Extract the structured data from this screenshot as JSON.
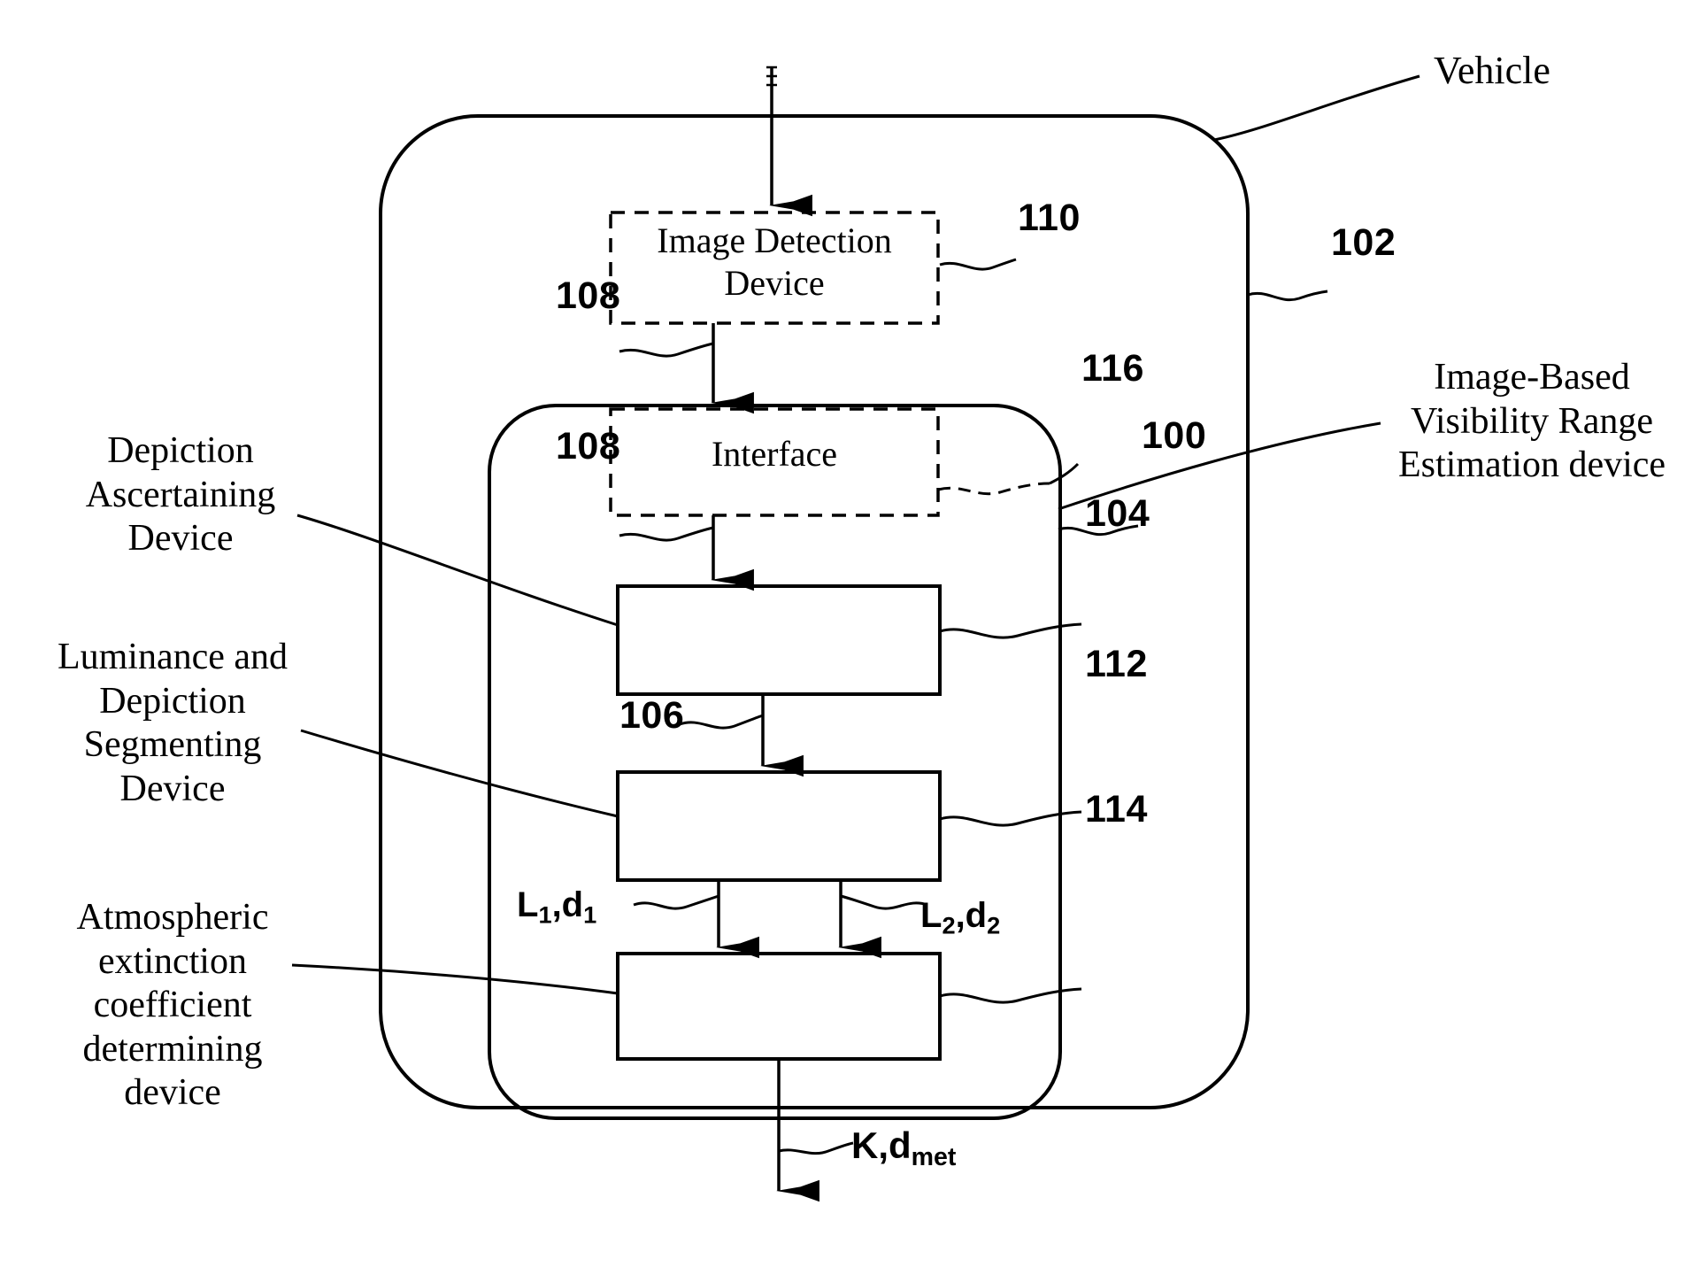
{
  "figure": {
    "type": "patent-block-diagram",
    "background": "#ffffff",
    "line_color": "#000000"
  },
  "outer_boundary": {
    "name": "vehicle-boundary",
    "label": "Vehicle",
    "reference": "102",
    "style": "solid rounded rectangle"
  },
  "inner_boundary": {
    "name": "visibility-range-estimation-boundary",
    "label": "Image-Based\nVisibility Range\nEstimation device",
    "reference": "100",
    "style": "solid rounded rectangle"
  },
  "blocks": [
    {
      "id": "image-detection-device",
      "label": "Image Detection\nDevice",
      "reference": "110",
      "border": "dashed"
    },
    {
      "id": "interface",
      "label": "Interface",
      "reference": "116",
      "border": "dashed"
    },
    {
      "id": "depiction-ascertaining-device",
      "label": "Depiction\nAscertaining\nDevice",
      "reference": "104",
      "border": "solid",
      "label_position": "left"
    },
    {
      "id": "luminance-and-depiction-segmenting-device",
      "label": "Luminance and\nDepiction\nSegmenting\nDevice",
      "reference": "112",
      "border": "solid",
      "label_position": "left"
    },
    {
      "id": "atmospheric-extinction-coefficient-determining-device",
      "label": "Atmospheric\nextinction\ncoefficient\ndetermining\ndevice",
      "reference": "114",
      "border": "solid",
      "label_position": "left"
    }
  ],
  "connectors": [
    {
      "id": "input-to-image-detection-device",
      "reference": null,
      "from": "external-input",
      "to": "image-detection-device"
    },
    {
      "id": "image-detection-to-interface",
      "reference": "108",
      "from": "image-detection-device",
      "to": "interface"
    },
    {
      "id": "interface-to-depiction-ascertaining",
      "reference": "108",
      "from": "interface",
      "to": "depiction-ascertaining-device"
    },
    {
      "id": "depiction-to-segmenting",
      "reference": "106",
      "from": "depiction-ascertaining-device",
      "to": "luminance-and-depiction-segmenting-device"
    },
    {
      "id": "segmenting-to-extinction-left",
      "signal": "L1,d1",
      "signal_base": "L",
      "from": "luminance-and-depiction-segmenting-device",
      "to": "atmospheric-extinction-coefficient-determining-device"
    },
    {
      "id": "segmenting-to-extinction-right",
      "signal": "L2,d2",
      "from": "luminance-and-depiction-segmenting-device",
      "to": "atmospheric-extinction-coefficient-determining-device"
    },
    {
      "id": "extinction-output",
      "signal": "K,dmet",
      "from": "atmospheric-extinction-coefficient-determining-device",
      "to": "external-output"
    }
  ],
  "signals": {
    "l1d1": {
      "main1": "L",
      "sub1": "1",
      "sep": ",d",
      "sub2": "1"
    },
    "l2d2": {
      "main1": "L",
      "sub1": "2",
      "sep": ",d",
      "sub2": "2"
    },
    "output": {
      "main": "K,d",
      "sub": "met"
    }
  },
  "references": {
    "vehicle": "102",
    "estimation_device": "100",
    "image_detection": "110",
    "interface": "116",
    "interface_in": "108",
    "interface_out": "108",
    "depiction_ascertaining": "104",
    "segmenting": "112",
    "extinction": "114",
    "between_104_112": "106"
  },
  "side_labels": {
    "vehicle": "Vehicle",
    "estimation_device": "Image-Based\nVisibility Range\nEstimation device",
    "depiction_ascertaining": "Depiction\nAscertaining\nDevice",
    "segmenting": "Luminance and\nDepiction\nSegmenting\nDevice",
    "extinction": "Atmospheric\nextinction\ncoefficient\ndetermining\ndevice"
  },
  "inner_box_labels": {
    "image_detection": "Image Detection\nDevice",
    "interface": "Interface"
  }
}
